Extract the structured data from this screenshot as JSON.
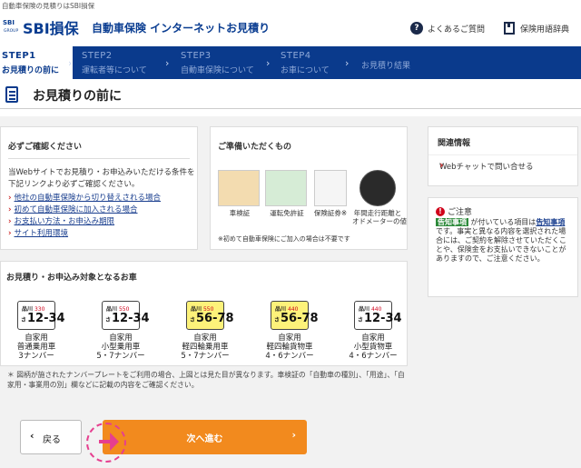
{
  "topline": "自動車保険の見積りはSBI損保",
  "header": {
    "logo_mark": "SBI",
    "logo_group": "GROUP",
    "logo": "SBI損保",
    "title": "自動車保険 インターネットお見積り",
    "faq": "よくあるご質問",
    "glossary": "保険用語辞典",
    "faq_icon": "question-icon",
    "glossary_icon": "book-icon"
  },
  "steps": [
    {
      "num": "STEP1",
      "label": "お見積りの前に"
    },
    {
      "num": "STEP2",
      "label": "運転者等について"
    },
    {
      "num": "STEP3",
      "label": "自動車保険について"
    },
    {
      "num": "STEP4",
      "label": "お車について"
    },
    {
      "num": "",
      "label": "お見積り結果"
    }
  ],
  "step_arrow": "›",
  "page_title": "お見積りの前に",
  "confirm": {
    "title": "必ずご確認ください",
    "intro": "当Webサイトでお見積り・お申込みいただける条件を下記リンクより必ずご確認ください。",
    "links": [
      "他社の自動車保険から切り替えされる場合",
      "初めて自動車保険に加入される場合",
      "お支払い方法・お申込み期限",
      "サイト利用環境"
    ]
  },
  "prepare": {
    "title": "ご準備いただくもの",
    "docs": [
      {
        "caption": "車検証"
      },
      {
        "caption": "運転免許証"
      },
      {
        "caption": "保険証券※"
      },
      {
        "caption": "年間走行距離と",
        "caption2": "オドメーターの値"
      }
    ],
    "note": "※初めて自動車保険にご加入の場合は不要です"
  },
  "plates": {
    "title": "お見積り・お申込み対象となるお車",
    "items": [
      {
        "region": "品川",
        "code": "330",
        "kana": "さ",
        "number": "12-34",
        "yellow": false,
        "l1": "自家用",
        "l2": "普通乗用車",
        "l3": "3ナンバー"
      },
      {
        "region": "品川",
        "code": "550",
        "kana": "さ",
        "number": "12-34",
        "yellow": false,
        "l1": "自家用",
        "l2": "小型乗用車",
        "l3": "5・7ナンバー"
      },
      {
        "region": "品川",
        "code": "550",
        "kana": "さ",
        "number": "56-78",
        "yellow": true,
        "l1": "自家用",
        "l2": "軽四輪乗用車",
        "l3": "5・7ナンバー"
      },
      {
        "region": "品川",
        "code": "440",
        "kana": "さ",
        "number": "56-78",
        "yellow": true,
        "l1": "自家用",
        "l2": "軽四輪貨物車",
        "l3": "4・6ナンバー"
      },
      {
        "region": "品川",
        "code": "440",
        "kana": "さ",
        "number": "12-34",
        "yellow": false,
        "l1": "自家用",
        "l2": "小型貨物車",
        "l3": "4・6ナンバー"
      }
    ]
  },
  "footnote": "＊ 図柄が施されたナンバープレートをご利用の場合、上図とは見た目が異なります。車検証の「自動車の種別」、「用途」、「自家用・事業用の別」欄などに記載の内容をご確認ください。",
  "side": {
    "title": "関連情報",
    "webchat": "Webチャットで問い合せる",
    "chevron": "›"
  },
  "caution": {
    "title": "ご注意",
    "warn_glyph": "!",
    "tag": "告知事項",
    "text_a": " が付いている項目は",
    "link": "告知事項",
    "text_b": "です。事実と異なる内容を選択された場合には、ご契約を解除させていただくことや、保険金をお支払いできないことがありますので、ご注意ください。"
  },
  "buttons": {
    "back": "戻る",
    "back_chev": "‹",
    "next": "次へ進む",
    "next_chev": "›"
  },
  "colors": {
    "brand": "#0a3a8c",
    "accent": "#f28a1e",
    "link": "#1a3f8f",
    "red": "#cc2222"
  }
}
